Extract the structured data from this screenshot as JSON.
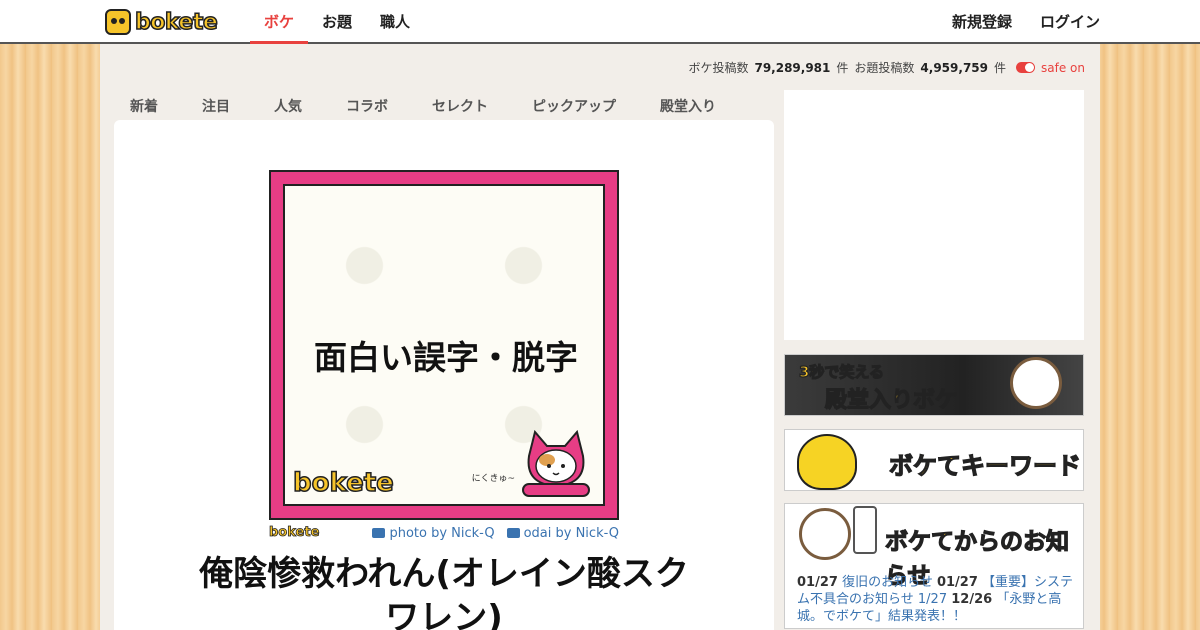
{
  "header": {
    "logo_text": "bokete",
    "nav": [
      {
        "label": "ボケ",
        "active": true
      },
      {
        "label": "お題",
        "active": false
      },
      {
        "label": "職人",
        "active": false
      }
    ],
    "signup": "新規登録",
    "login": "ログイン"
  },
  "stats": {
    "boke_label": "ボケ投稿数",
    "boke_count": "79,289,981",
    "boke_unit": "件",
    "odai_label": "お題投稿数",
    "odai_count": "4,959,759",
    "odai_unit": "件",
    "safe": "safe on"
  },
  "tabs": [
    "新着",
    "注目",
    "人気",
    "コラボ",
    "セレクト",
    "ピックアップ",
    "殿堂入り"
  ],
  "odai": {
    "image_text": "面白い誤字・脱字",
    "frame_logo": "bokete",
    "signature": "にくきゅ~",
    "meta_logo": "bokete",
    "photo_credit": "photo by Nick-Q",
    "odai_credit": "odai by Nick-Q"
  },
  "boke": {
    "title": "俺陰惨救われん(オレイン酸スクワレン)"
  },
  "sidebar": {
    "banner1_small": "3秒で笑える",
    "banner1_big": "殿堂入りボケ",
    "banner2": "ボケてキーワード",
    "banner3": "ボケてからのお知らせ",
    "news": [
      {
        "date": "01/27",
        "text": "復旧のお知らせ"
      },
      {
        "date": "01/27",
        "text": "【重要】システム不具合のお知らせ"
      },
      {
        "date": "1/27",
        "text": ""
      },
      {
        "date": "12/26",
        "text": "「永野と高城。でボケて」結果発表！！"
      }
    ]
  },
  "colors": {
    "accent": "#e8413e",
    "frame": "#e73d85",
    "link": "#3a73b0",
    "logo_yellow": "#f6c42a"
  }
}
